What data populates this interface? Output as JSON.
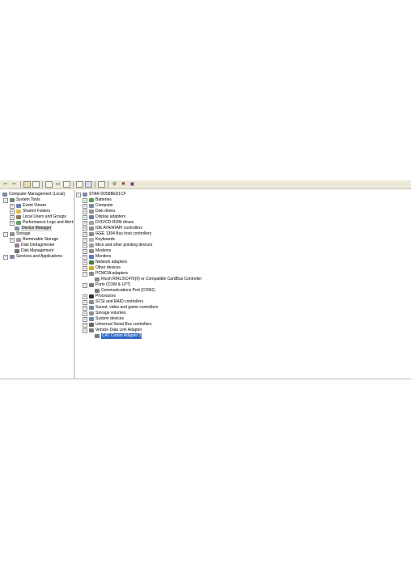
{
  "toolbar": {
    "icons": [
      "back-icon",
      "forward-icon",
      "up-icon",
      "show-hide-tree-icon",
      "properties-icon",
      "print-icon",
      "refresh-icon",
      "export-icon",
      "help-icon",
      "view-icon",
      "scan-hardware-icon",
      "update-driver-icon",
      "disable-icon",
      "uninstall-icon"
    ]
  },
  "left_tree": {
    "root": "Computer Management (Local)",
    "system_tools": "System Tools",
    "event_viewer": "Event Viewer",
    "shared_folders": "Shared Folders",
    "local_users": "Local Users and Groups",
    "perf_logs": "Performance Logs and Alert:",
    "device_manager": "Device Manager",
    "storage": "Storage",
    "removable_storage": "Removable Storage",
    "disk_defrag": "Disk Defragmenter",
    "disk_management": "Disk Management",
    "services": "Services and Applications"
  },
  "device_tree": {
    "root": "STAR-0D588ED1CF",
    "items": [
      "Batteries",
      "Computer",
      "Disk drives",
      "Display adapters",
      "DVD/CD-ROM drives",
      "IDE ATA/ATAPI controllers",
      "IEEE 1394 Bus host controllers",
      "Keyboards",
      "Mice and other pointing devices",
      "Modems",
      "Monitors",
      "Network adapters",
      "Other devices",
      "PCMCIA adapters",
      "Ricoh R/RL/5C476(II) or Compatible CardBus Controller",
      "Ports (COM & LPT)",
      "Communications Port (COM1)",
      "Processors",
      "SCSI and RAID controllers",
      "Sound, video and game controllers",
      "Storage volumes",
      "System devices",
      "Universal Serial Bus controllers",
      "Vehicle Data Link Adapter",
      "CAT Comm Adapter 3"
    ]
  }
}
